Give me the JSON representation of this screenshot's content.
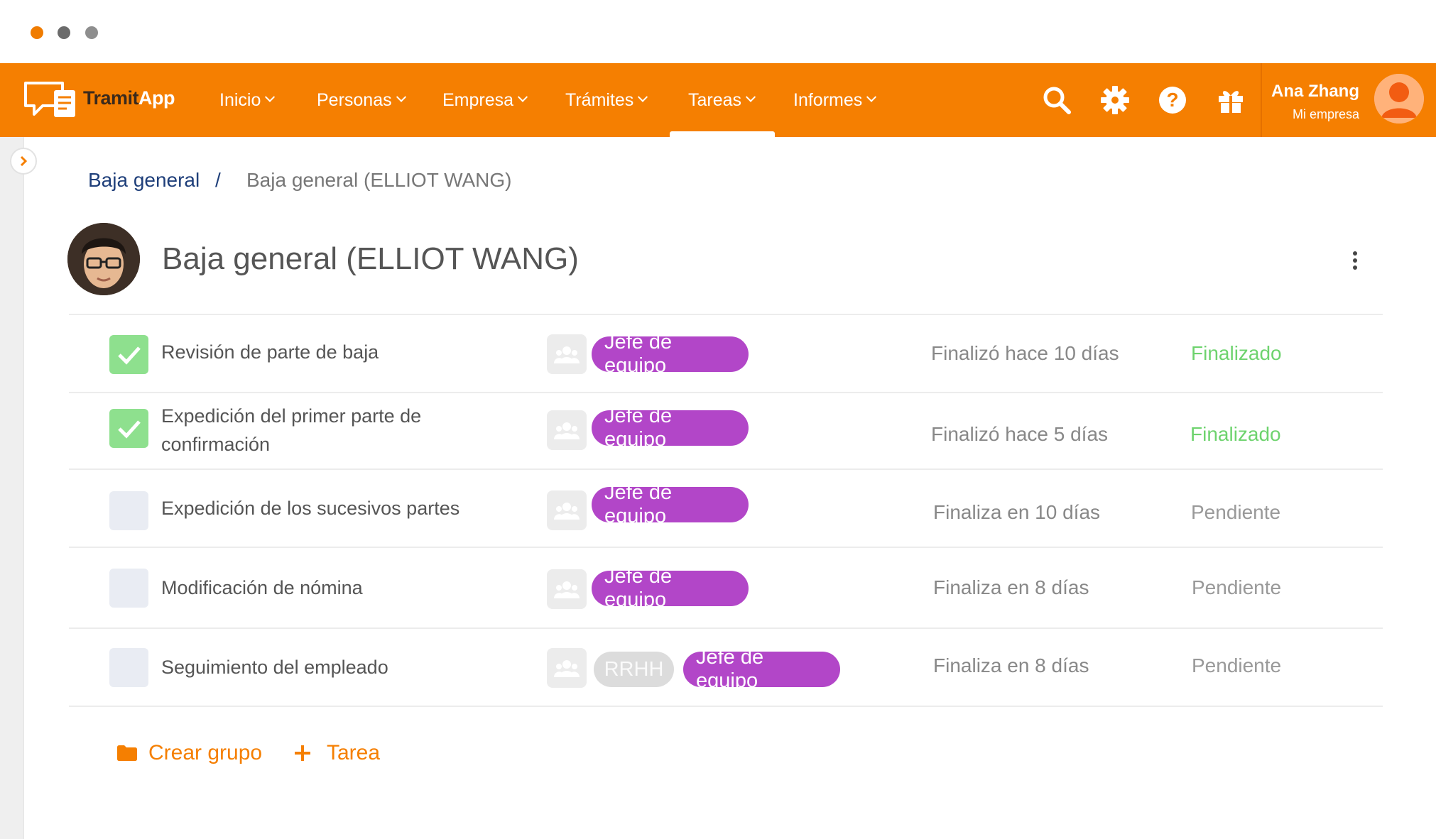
{
  "app": {
    "brand_part1": "Tramit",
    "brand_part2": "App",
    "accent_color": "#f57f01"
  },
  "nav": {
    "items": [
      {
        "label": "Inicio"
      },
      {
        "label": "Personas"
      },
      {
        "label": "Empresa"
      },
      {
        "label": "Trámites"
      },
      {
        "label": "Tareas",
        "active": true
      },
      {
        "label": "Informes"
      }
    ],
    "icons": [
      "search-icon",
      "gear-icon",
      "help-icon",
      "gift-icon"
    ]
  },
  "user": {
    "name": "Ana Zhang",
    "company": "Mi empresa"
  },
  "breadcrumb": {
    "parent": "Baja general",
    "separator": "/",
    "current": "Baja general (ELLIOT WANG)"
  },
  "page": {
    "title": "Baja general (ELLIOT WANG)"
  },
  "tasks": [
    {
      "name": "Revisión de parte de baja",
      "done": true,
      "roles": [
        "Jefe de equipo"
      ],
      "due": "Finalizó hace 10 días",
      "status": "Finalizado"
    },
    {
      "name": "Expedición del primer parte de confirmación",
      "done": true,
      "roles": [
        "Jefe de equipo"
      ],
      "due": "Finalizó hace 5 días",
      "status": "Finalizado"
    },
    {
      "name": "Expedición de los sucesivos partes",
      "done": false,
      "roles": [
        "Jefe de equipo"
      ],
      "due": "Finaliza en 10 días",
      "status": "Pendiente"
    },
    {
      "name": "Modificación de nómina",
      "done": false,
      "roles": [
        "Jefe de equipo"
      ],
      "due": "Finaliza en 8 días",
      "status": "Pendiente"
    },
    {
      "name": "Seguimiento del empleado",
      "done": false,
      "roles": [
        "RRHH",
        "Jefe de equipo"
      ],
      "due": "Finaliza en 8 días",
      "status": "Pendiente"
    }
  ],
  "actions": {
    "create_group": "Crear grupo",
    "add_task": "Tarea"
  }
}
